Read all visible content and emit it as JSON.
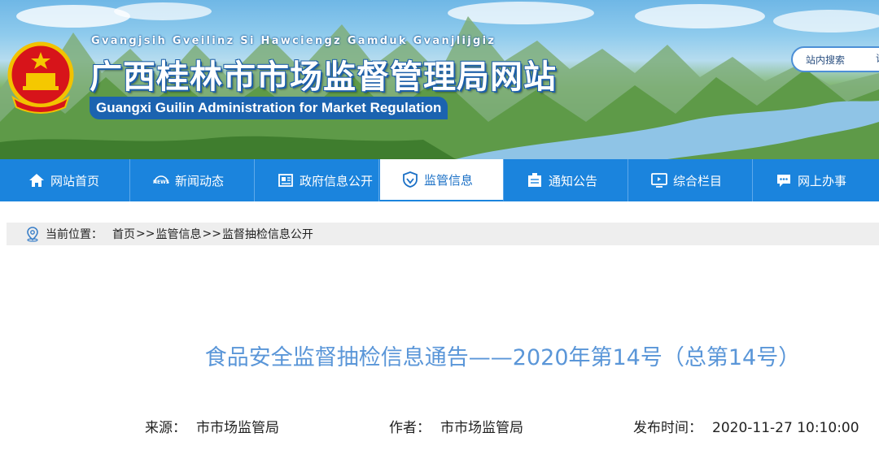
{
  "header": {
    "pinyin": "Gvangjsih Gveilinz Si Hawciengz Gamduk Gvanjlijgiz",
    "title_zh": "广西桂林市市场监督管理局网站",
    "title_en": "Guangxi Guilin Administration for Market Regulation",
    "emblem_icon": "national-emblem-icon"
  },
  "search": {
    "placeholder": "站内搜索",
    "button_label": "请"
  },
  "nav": {
    "items": [
      {
        "label": "网站首页",
        "icon": "home-icon"
      },
      {
        "label": "新闻动态",
        "icon": "news-icon"
      },
      {
        "label": "政府信息公开",
        "icon": "document-icon"
      },
      {
        "label": "监管信息",
        "icon": "shield-icon",
        "active": true
      },
      {
        "label": "通知公告",
        "icon": "notice-icon"
      },
      {
        "label": "综合栏目",
        "icon": "monitor-icon"
      },
      {
        "label": "网上办事",
        "icon": "chat-icon"
      }
    ],
    "active_index": 3
  },
  "breadcrumb": {
    "prefix": "当前位置：",
    "items": [
      "首页",
      "监管信息",
      "监督抽检信息公开"
    ],
    "separator": ">>"
  },
  "article": {
    "title": "食品安全监督抽检信息通告——2020年第14号（总第14号）",
    "source_label": "来源：",
    "source": "市市场监管局",
    "author_label": "作者：",
    "author": "市市场监管局",
    "time_label": "发布时间：",
    "time": "2020-11-27 10:10:00"
  },
  "colors": {
    "nav_bg": "#1b84dd",
    "title_color": "#5a96d8",
    "crumb_bg": "#eeeeee"
  }
}
